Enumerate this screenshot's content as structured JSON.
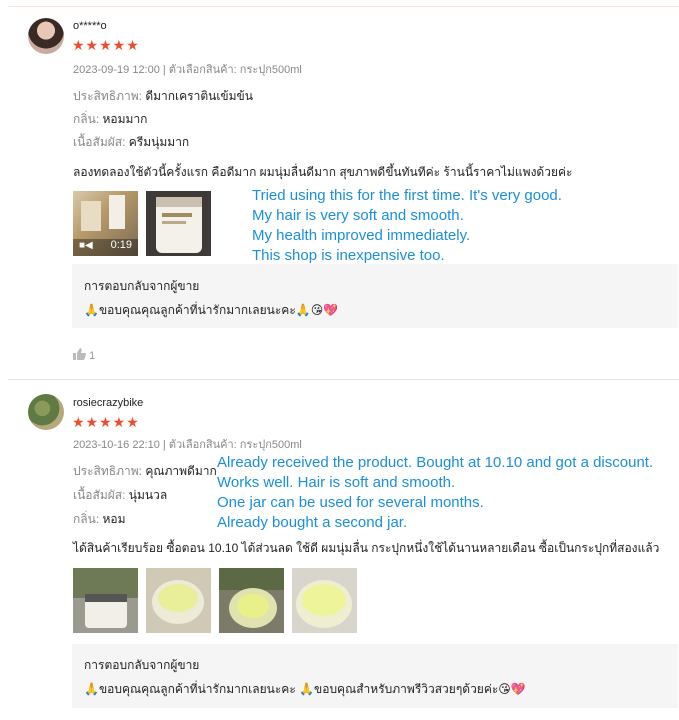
{
  "reviews": [
    {
      "username": "o*****o",
      "stars": "★★★★★",
      "meta": "2023-09-19 12:00 | ตัวเลือกสินค้า: กระปุก500ml",
      "attributes": [
        {
          "key": "ประสิทธิภาพ:",
          "value": "ดีมากเคราตินเข้มข้น"
        },
        {
          "key": "กลิ่น:",
          "value": "หอมมาก"
        },
        {
          "key": "เนื้อสัมผัส:",
          "value": "ครีมนุ่มมาก"
        }
      ],
      "comment": "ลองทดลองใช้ตัวนี้ครั้งแรก คือดีมาก ผมนุ่มลื่นดีมาก สุขภาพดีขึ้นทันทีค่ะ ร้านนี้ราคาไม่แพงด้วยค่ะ",
      "video_duration": "0:19",
      "overlay": [
        "Tried using this for the first time. It's very good.",
        "My hair is very soft and smooth.",
        "My health improved immediately.",
        "This shop is inexpensive too."
      ],
      "reply_title": "การตอบกลับจากผู้ขาย",
      "reply_text": "🙏ขอบคุณคุณลูกค้าที่น่ารักมากเลยนะคะ🙏😘💖",
      "likes": "1"
    },
    {
      "username": "rosiecrazybike",
      "stars": "★★★★★",
      "meta": "2023-10-16 22:10 | ตัวเลือกสินค้า: กระปุก500ml",
      "attributes": [
        {
          "key": "ประสิทธิภาพ:",
          "value": "คุณภาพดีมาก"
        },
        {
          "key": "เนื้อสัมผัส:",
          "value": "นุ่มนวล"
        },
        {
          "key": "กลิ่น:",
          "value": "หอม"
        }
      ],
      "comment": "ได้สินค้าเรียบร้อย ซื้อตอน 10.10 ได้ส่วนลด ใช้ดี ผมนุ่มลื่น กระปุกหนึ่งใช้ได้นานหลายเดือน ซื้อเป็นกระปุกที่สองแล้ว",
      "overlay": [
        "Already received the product. Bought at 10.10 and got a discount.",
        "Works well. Hair is soft and smooth.",
        "One jar can be used for several months.",
        "Already bought a second jar."
      ],
      "reply_title": "การตอบกลับจากผู้ขาย",
      "reply_text": "🙏ขอบคุณคุณลูกค้าที่น่ารักมากเลยนะคะ 🙏ขอบคุณสำหรับภาพรีวิวสวยๆด้วยค่ะ😘💖"
    }
  ],
  "icons": {
    "like": "thumbs-up-icon",
    "video": "video-camera-icon"
  }
}
